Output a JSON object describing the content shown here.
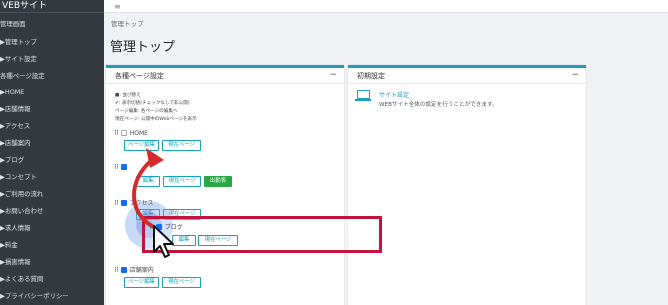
{
  "sidebar": {
    "brand": "VEBサイト",
    "items": [
      {
        "label": "管理画面"
      },
      {
        "label": "▶管理トップ"
      },
      {
        "label": "▶サイト設定"
      },
      {
        "label": "各種ページ設定"
      },
      {
        "label": "▶HOME"
      },
      {
        "label": "▶店舗情報"
      },
      {
        "label": "▶アクセス"
      },
      {
        "label": "▶店舗案内"
      },
      {
        "label": "▶ブログ"
      },
      {
        "label": "▶コンセプト"
      },
      {
        "label": "▶ご利用の流れ"
      },
      {
        "label": "▶お問い合わせ"
      },
      {
        "label": "▶求人情報"
      },
      {
        "label": "▶料金"
      },
      {
        "label": "▶損害情報"
      },
      {
        "label": "▶よくある質問"
      },
      {
        "label": "▶プライバシーポリシー"
      }
    ]
  },
  "topbar": {
    "menu_icon": "≡"
  },
  "breadcrumb": "管理トップ",
  "page_title": "管理トップ",
  "pages_card": {
    "title": "各種ページ設定",
    "collapse": "−",
    "notes": [
      "■: 並び替え",
      "✔: 表示切替(チェックなしで非公開)",
      "ページ編集: 各ページの編集へ",
      "現在ページ: 公開中のWebページを表示"
    ],
    "rows": [
      {
        "label": "HOME",
        "checked": false
      },
      {
        "label": "",
        "checked": true
      },
      {
        "label": "アクセス",
        "checked": true
      },
      {
        "label": "ブログ",
        "checked": true
      },
      {
        "label": "店舗案内",
        "checked": true
      }
    ],
    "edit_label": "ページ編集",
    "edit_label_short": "編集",
    "view_label": "現在ページ",
    "green_label": "出勤表"
  },
  "init_card": {
    "title": "初期設定",
    "collapse": "−",
    "site_settings_title": "サイト設定",
    "site_settings_desc": "WEBサイト全体の設定を行うことができます。"
  },
  "colors": {
    "sidebar_bg": "#343a40",
    "card_accent": "#17a2b8",
    "highlight_red": "#c0143c",
    "arrow_red": "#d42a2a",
    "green": "#28a745"
  }
}
